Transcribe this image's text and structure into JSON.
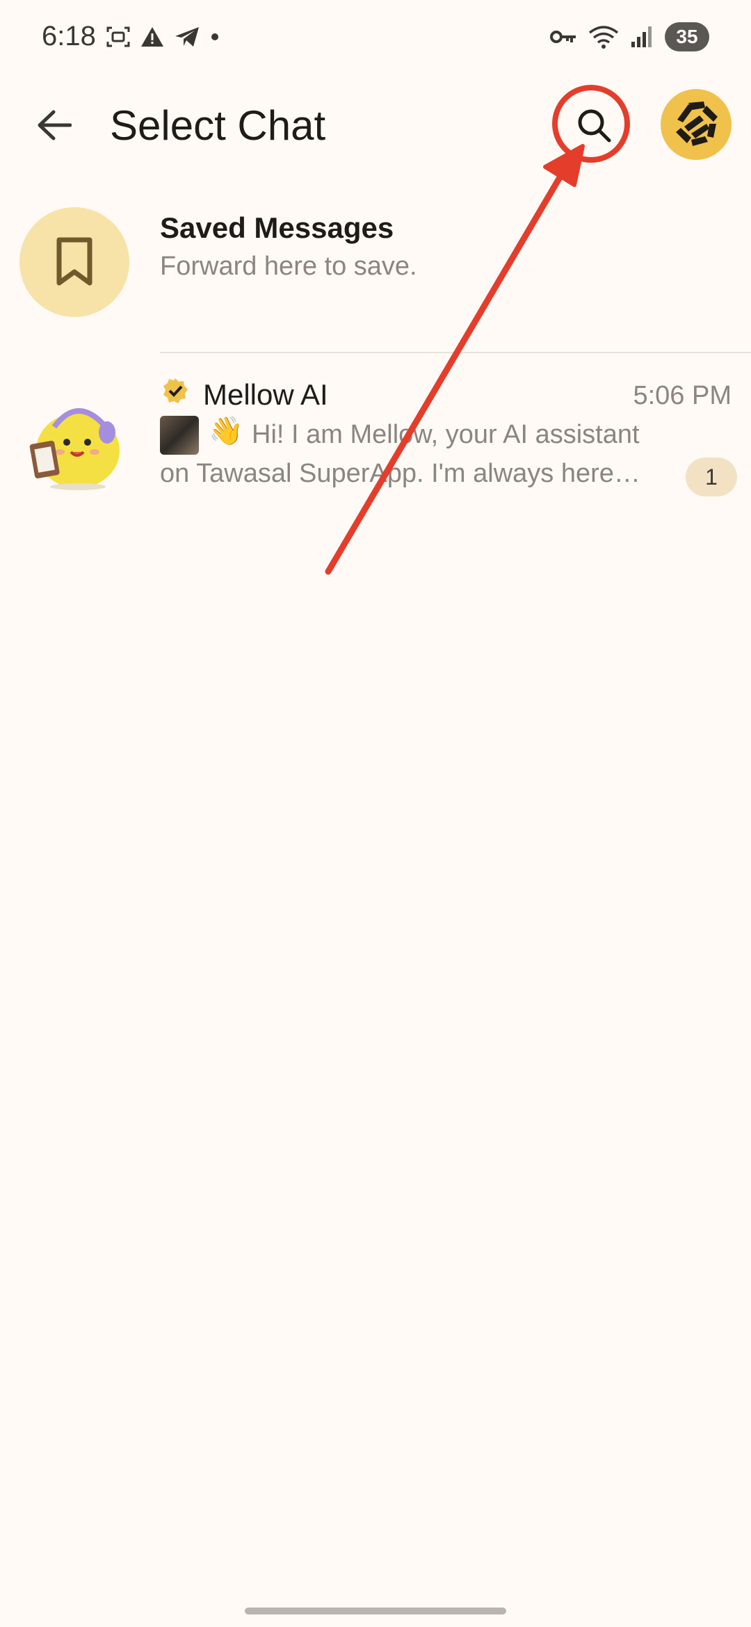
{
  "status_bar": {
    "time": "6:18",
    "battery": "35",
    "icons_left": [
      "screenshot-icon",
      "warning-icon",
      "telegram-icon",
      "dot-icon"
    ],
    "icons_right": [
      "vpn-key-icon",
      "wifi-icon",
      "signal-icon"
    ]
  },
  "header": {
    "title": "Select Chat",
    "back_icon": "arrow-left-icon",
    "search_icon": "search-icon",
    "highlight_color": "#e53d2b"
  },
  "chats": {
    "saved": {
      "title": "Saved Messages",
      "subtitle": "Forward here to save.",
      "icon": "bookmark-icon"
    },
    "mellow": {
      "title": "Mellow AI",
      "time": "5:06 PM",
      "preview_emoji": "👋",
      "preview_line1": "Hi! I am Mellow, your AI assistant",
      "preview_line2": "on Tawasal SuperApp.  I'm always here…",
      "unread": "1",
      "verified": true
    }
  },
  "colors": {
    "background": "#fffaf6",
    "accent": "#f0c14b",
    "annotation": "#e53d2b"
  }
}
